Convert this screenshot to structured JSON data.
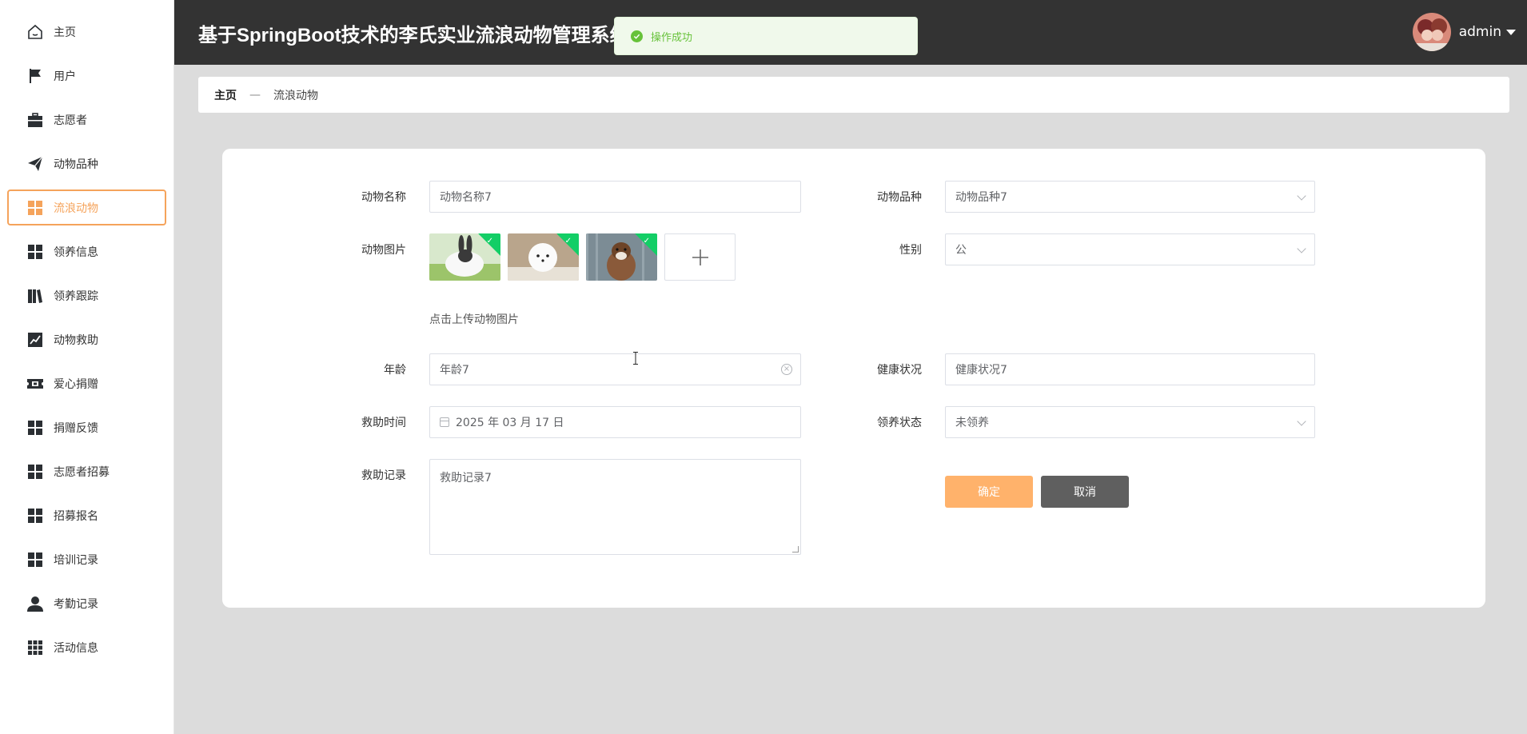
{
  "header": {
    "title": "基于SpringBoot技术的李氏实业流浪动物管理系统",
    "user": "admin"
  },
  "toast": {
    "message": "操作成功"
  },
  "sidebar": {
    "items": [
      {
        "label": "主页",
        "icon": "home-icon"
      },
      {
        "label": "用户",
        "icon": "flag-icon"
      },
      {
        "label": "志愿者",
        "icon": "briefcase-icon"
      },
      {
        "label": "动物品种",
        "icon": "paper-plane-icon"
      },
      {
        "label": "流浪动物",
        "icon": "grid-icon",
        "active": true
      },
      {
        "label": "领养信息",
        "icon": "grid-icon"
      },
      {
        "label": "领养跟踪",
        "icon": "book-icon"
      },
      {
        "label": "动物救助",
        "icon": "chart-line-icon"
      },
      {
        "label": "爱心捐赠",
        "icon": "ticket-icon"
      },
      {
        "label": "捐赠反馈",
        "icon": "grid-icon"
      },
      {
        "label": "志愿者招募",
        "icon": "grid-icon"
      },
      {
        "label": "招募报名",
        "icon": "grid-icon"
      },
      {
        "label": "培训记录",
        "icon": "grid-icon"
      },
      {
        "label": "考勤记录",
        "icon": "person-icon"
      },
      {
        "label": "活动信息",
        "icon": "apps-icon"
      }
    ]
  },
  "breadcrumb": {
    "home": "主页",
    "separator": "—",
    "current": "流浪动物"
  },
  "form": {
    "name": {
      "label": "动物名称",
      "value": "动物名称7"
    },
    "breed": {
      "label": "动物品种",
      "value": "动物品种7"
    },
    "image": {
      "label": "动物图片",
      "hint": "点击上传动物图片"
    },
    "gender": {
      "label": "性别",
      "value": "公"
    },
    "age": {
      "label": "年龄",
      "value": "年龄7"
    },
    "health": {
      "label": "健康状况",
      "value": "健康状况7"
    },
    "rescue_time": {
      "label": "救助时间",
      "value": "2025 年 03 月 17 日"
    },
    "adopt_status": {
      "label": "领养状态",
      "value": "未领养"
    },
    "rescue_record": {
      "label": "救助记录",
      "value": "救助记录7"
    },
    "ok_label": "确定",
    "cancel_label": "取消"
  },
  "colors": {
    "accent": "#f5a35b",
    "header": "#333333",
    "success": "#67c23a",
    "ok_button": "#ffb26b",
    "cancel_button": "#5f5f5f"
  }
}
